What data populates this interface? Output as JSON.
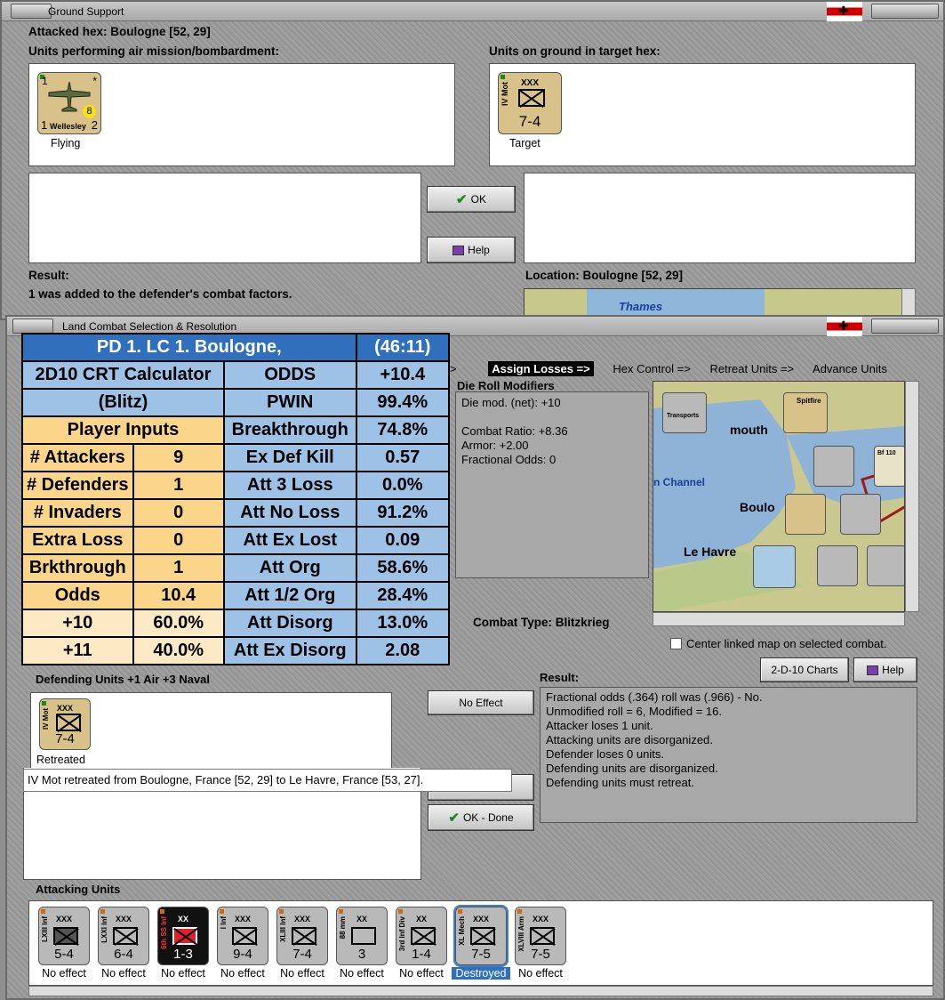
{
  "gs": {
    "title": "Ground Support",
    "attacked_hex": "Attacked hex: Boulogne  [52, 29]",
    "air_label": "Units performing air mission/bombardment:",
    "ground_label": "Units on ground in target hex:",
    "air_unit": {
      "name": "Wellesley",
      "left": "1",
      "right": "2",
      "top": "1",
      "badge": "8",
      "star": "*",
      "caption": "Flying"
    },
    "ground_unit": {
      "size": "XXX",
      "side": "IV Mot",
      "strength": "7-4",
      "caption": "Target"
    },
    "ok": "OK",
    "help": "Help",
    "result_label": "Result:",
    "result_text": "1 was added to the defender's combat factors.",
    "location": "Location:  Boulogne  [52, 29]",
    "map_label": "Thames"
  },
  "lc": {
    "title": "Land Combat Selection & Resolution",
    "tabs": [
      ">",
      "Assign Losses =>",
      "Hex Control =>",
      "Retreat Units =>",
      "Advance Units"
    ],
    "drm_title": "Die Roll Modifiers",
    "drm_lines": [
      "Die mod. (net): +10",
      "",
      "Combat Ratio: +8.36",
      "Armor: +2.00",
      "Fractional Odds: 0"
    ],
    "combat_type": "Combat Type:  Blitzkrieg",
    "center_label": "Center linked map on selected combat.",
    "charts_btn": "2-D-10 Charts",
    "help": "Help",
    "defending_label": "Defending Units +1 Air +3 Naval",
    "def_unit": {
      "size": "XXX",
      "side": "IV Mot",
      "strength": "7-4",
      "caption": "Retreated"
    },
    "no_effect": "No Effect",
    "result_label": "Result:",
    "result_lines": [
      "Fractional odds (.364) roll was (.966)  - No.",
      "Unmodified roll = 6, Modified = 16.",
      "Attacker loses 1 unit.",
      "Attacking units are disorganized.",
      "Defender loses 0 units.",
      "Defending units are disorganized.",
      "Defending units must retreat."
    ],
    "retreat_msg": "IV Mot retreated from Boulogne, France [52, 29] to Le Havre, France [53, 27].",
    "ok_done": "OK - Done",
    "attacking_label": "Attacking Units",
    "map": {
      "labels": [
        "mouth",
        "n Channel",
        "Boulo",
        "Le Havre"
      ],
      "spitfire": "Spitfire",
      "transports": "Transports",
      "bf": "Bf 110"
    },
    "attackers": [
      {
        "size": "XXX",
        "side": "LXIII Inf",
        "strength": "5-4",
        "caption": "No effect",
        "bg": "#b9b9b9",
        "sym": "filled"
      },
      {
        "size": "XXX",
        "side": "LXXI Inf",
        "strength": "6-4",
        "caption": "No effect",
        "bg": "#b9b9b9",
        "sym": "x"
      },
      {
        "size": "XX",
        "side": "6th SS Inf",
        "strength": "1-3",
        "caption": "No effect",
        "bg": "#111111",
        "sym": "red"
      },
      {
        "size": "XXX",
        "side": "I Inf",
        "strength": "9-4",
        "caption": "No effect",
        "bg": "#b9b9b9",
        "sym": "x"
      },
      {
        "size": "XXX",
        "side": "XLIII Inf",
        "strength": "7-4",
        "caption": "No effect",
        "bg": "#b9b9b9",
        "sym": "x"
      },
      {
        "size": "XX",
        "side": "88 mm",
        "strength": "3",
        "caption": "No effect",
        "bg": "#b9b9b9",
        "sym": "aa"
      },
      {
        "size": "XX",
        "side": "3rd Inf Div",
        "strength": "1-4",
        "caption": "No effect",
        "bg": "#b9b9b9",
        "sym": "x"
      },
      {
        "size": "XXX",
        "side": "XL Mech",
        "strength": "7-5",
        "caption": "Destroyed",
        "bg": "#b9b9b9",
        "sym": "x"
      },
      {
        "size": "XXX",
        "side": "XLVIII Arm",
        "strength": "7-5",
        "caption": "No effect",
        "bg": "#b9b9b9",
        "sym": "arm"
      }
    ]
  },
  "crt": {
    "title": "PD 1.  LC 1.  Boulogne,",
    "time": "(46:11)",
    "calc1": "2D10 CRT Calculator",
    "calc2": "(Blitz)",
    "player_inputs": "Player Inputs",
    "inputs": [
      {
        "k": "# Attackers",
        "v": "9"
      },
      {
        "k": "# Defenders",
        "v": "1"
      },
      {
        "k": "# Invaders",
        "v": "0"
      },
      {
        "k": "Extra Loss",
        "v": "0"
      },
      {
        "k": "Brkthrough",
        "v": "1"
      },
      {
        "k": "Odds",
        "v": "10.4"
      }
    ],
    "odds_rows": [
      {
        "k": "+10",
        "v": "60.0%"
      },
      {
        "k": "+11",
        "v": "40.0%"
      }
    ],
    "stats": [
      {
        "k": "ODDS",
        "v": "+10.4"
      },
      {
        "k": "PWIN",
        "v": "99.4%"
      },
      {
        "k": "Breakthrough",
        "v": "74.8%"
      },
      {
        "k": "Ex Def Kill",
        "v": "0.57"
      },
      {
        "k": "Att 3 Loss",
        "v": "0.0%"
      },
      {
        "k": "Att No Loss",
        "v": "91.2%"
      },
      {
        "k": "Att Ex Lost",
        "v": "0.09"
      },
      {
        "k": "Att Org",
        "v": "58.6%"
      },
      {
        "k": "Att 1/2 Org",
        "v": "28.4%"
      },
      {
        "k": "Att Disorg",
        "v": "13.0%"
      },
      {
        "k": "Att Ex Disorg",
        "v": "2.08"
      }
    ]
  }
}
